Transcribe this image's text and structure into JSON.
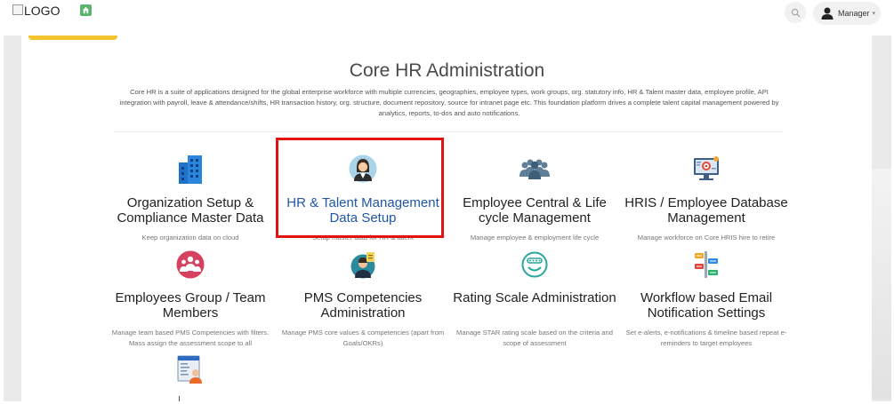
{
  "header": {
    "logo_alt": "LOGO",
    "user_label": "Manager"
  },
  "main": {
    "title": "Core HR Administration",
    "description": "Core HR is a suite of applications designed for the global enterprise workforce with multiple currencies, geographies, employee types, work groups, org. statutory info, HR & Talent master data, employee profile, API integration with payroll, leave & attendance/shifts, HR transaction history, org. structure, document repository, source for intranet page etc. This foundation platform drives a complete talent capital management powered by analytics, reports, to-dos and auto notifications."
  },
  "cards": [
    {
      "title": "Organization Setup & Compliance Master Data",
      "subtitle": "Keep organization data on cloud",
      "icon": "building-icon"
    },
    {
      "title": "HR & Talent Management Data Setup",
      "subtitle": "Setup master data for HR & talent",
      "icon": "person-avatar-icon"
    },
    {
      "title": "Employee Central & Life cycle Management",
      "subtitle": "Manage employee & employment life cycle",
      "icon": "people-group-icon"
    },
    {
      "title": "HRIS / Employee Database Management",
      "subtitle": "Manage workforce on Core HRIS hire to retire",
      "icon": "monitor-icon"
    },
    {
      "title": "Employees Group / Team Members",
      "subtitle": "Manage team based PMS Competencies with filters. Mass assign the assessment scope to all",
      "icon": "team-circle-icon"
    },
    {
      "title": "PMS Competencies Administration",
      "subtitle": "Manage PMS core values & competencies (apart from Goals/OKRs)",
      "icon": "competency-icon"
    },
    {
      "title": "Rating Scale Administration",
      "subtitle": "Manage STAR rating scale based on the criteria and scope of assessment",
      "icon": "rating-scale-icon"
    },
    {
      "title": "Workflow based Email Notification Settings",
      "subtitle": "Set e-alerts, e-notifications & timeline based repeat e-reminders to target employees",
      "icon": "workflow-icon"
    }
  ],
  "colors": {
    "accent_yellow": "#f4c330",
    "highlight_red": "#e31212",
    "active_title_blue": "#1f57a6",
    "home_green": "#5ab46c"
  }
}
